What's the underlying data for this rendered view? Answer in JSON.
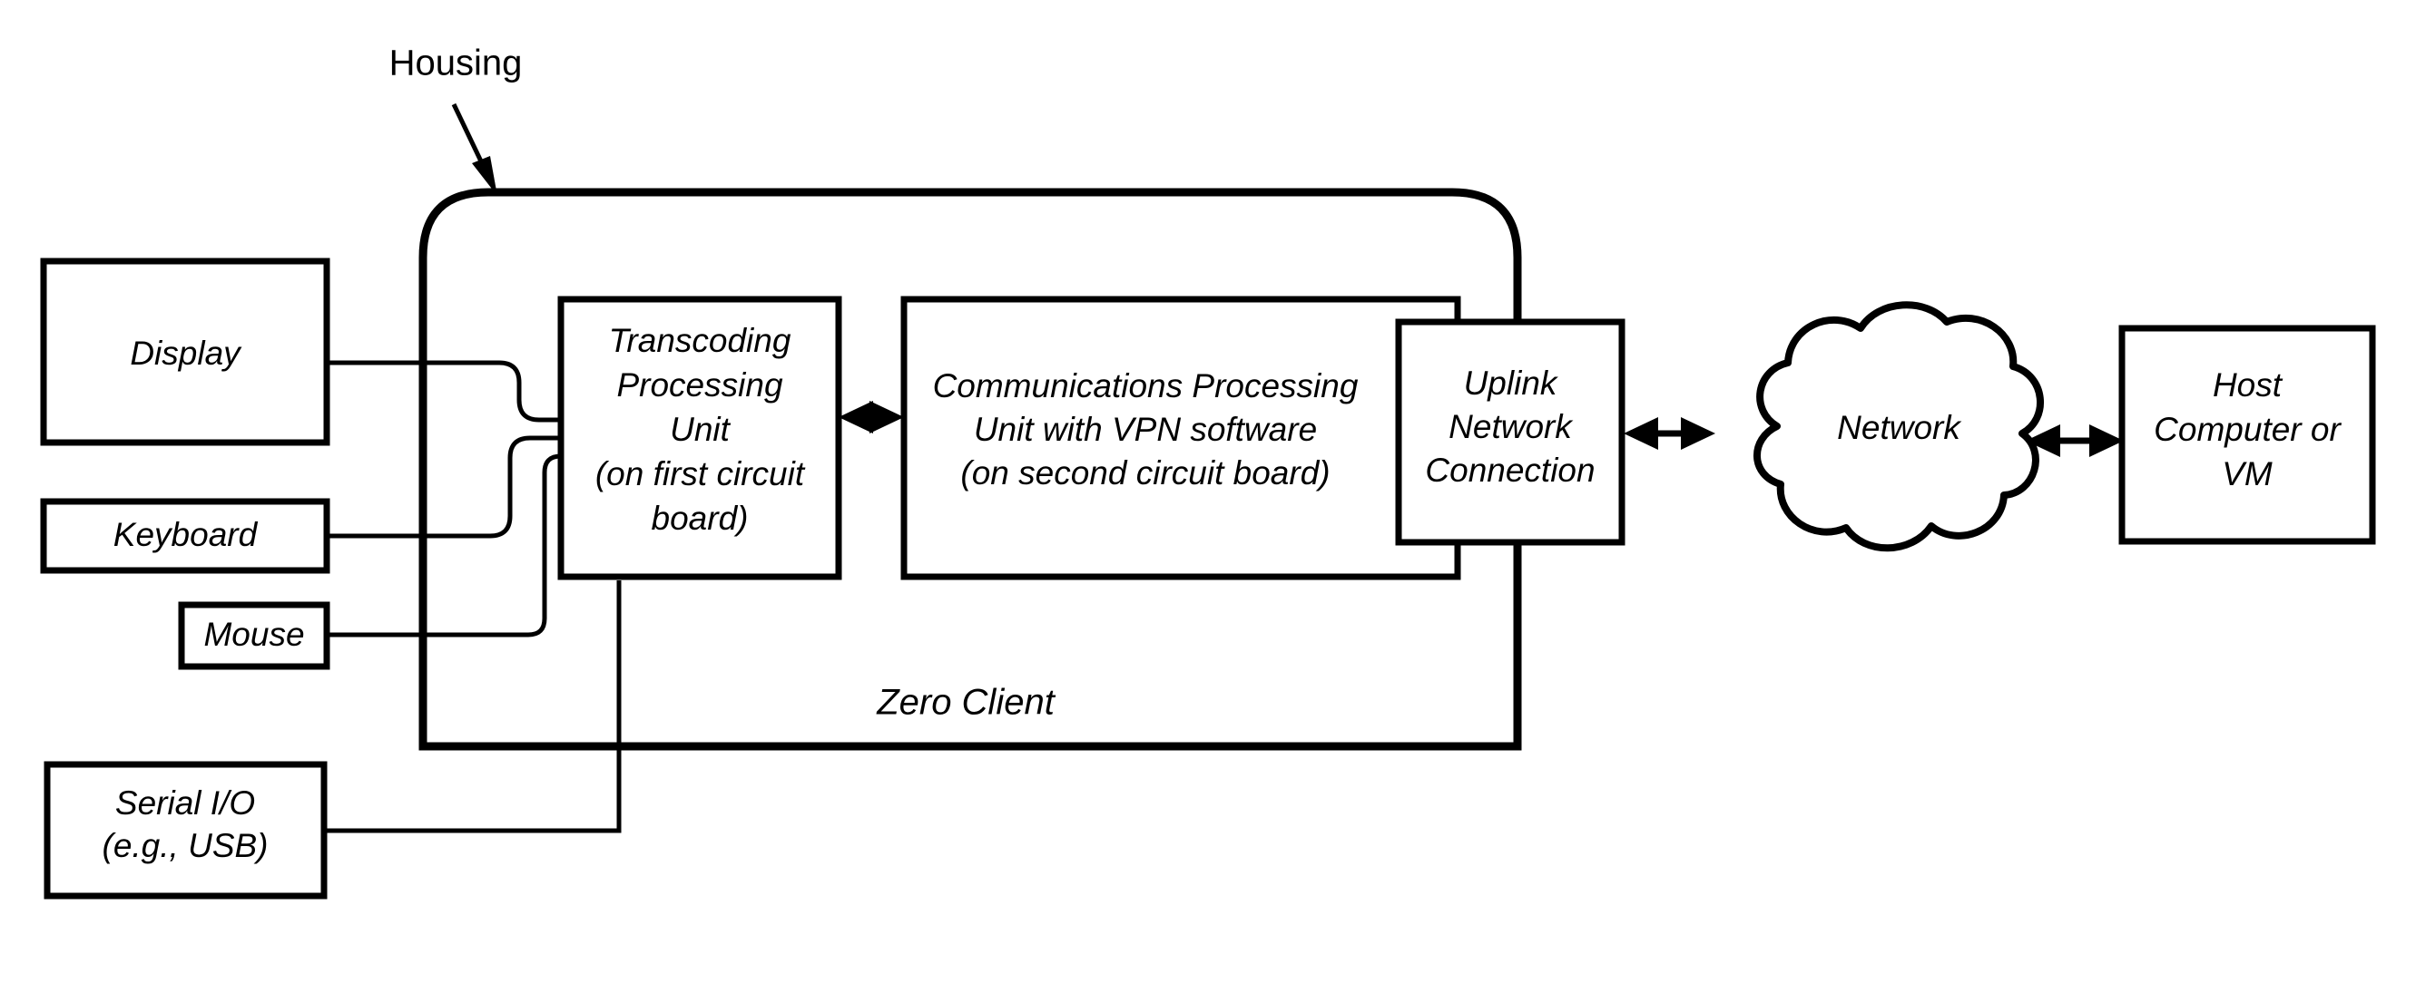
{
  "diagram": {
    "title_annotation": "Housing",
    "system_label": "Zero Client",
    "nodes": {
      "display": {
        "label": "Display"
      },
      "keyboard": {
        "label": "Keyboard"
      },
      "mouse": {
        "label": "Mouse"
      },
      "serial_io": {
        "line1": "Serial I/O",
        "line2": "(e.g., USB)"
      },
      "transcoding": {
        "line1": "Transcoding",
        "line2": "Processing",
        "line3": "Unit",
        "line4": "(on first circuit",
        "line5": "board)"
      },
      "communications": {
        "line1": "Communications Processing",
        "line2": "Unit with VPN software",
        "line3": "(on second circuit board)"
      },
      "uplink": {
        "line1": "Uplink",
        "line2": "Network",
        "line3": "Connection"
      },
      "network": {
        "label": "Network"
      },
      "host": {
        "line1": "Host",
        "line2": "Computer or",
        "line3": "VM"
      }
    },
    "colors": {
      "stroke": "#000000",
      "fill": "#ffffff",
      "background": "#ffffff"
    }
  }
}
